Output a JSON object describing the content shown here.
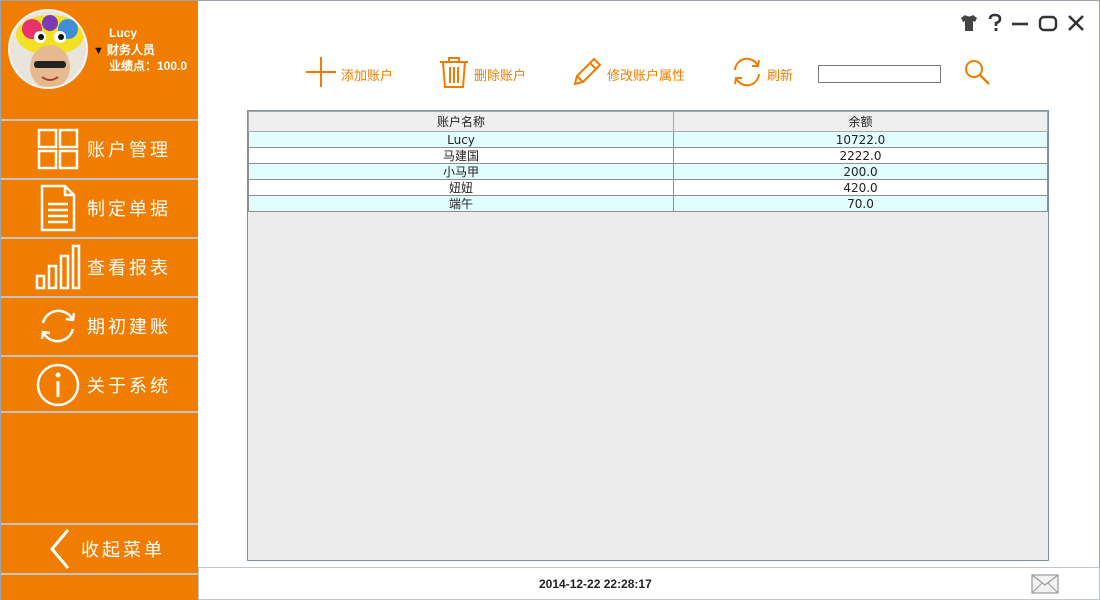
{
  "user": {
    "name": "Lucy",
    "role": "财务人员",
    "score_label": "业绩点：100.0"
  },
  "sidebar": {
    "items": [
      {
        "label": "账户管理",
        "icon": "grid-icon"
      },
      {
        "label": "制定单据",
        "icon": "document-icon"
      },
      {
        "label": "查看报表",
        "icon": "bar-chart-icon"
      },
      {
        "label": "期初建账",
        "icon": "refresh-icon"
      },
      {
        "label": "关于系统",
        "icon": "info-icon"
      }
    ],
    "collapse_label": "收起菜单"
  },
  "toolbar": {
    "add_label": "添加账户",
    "delete_label": "删除账户",
    "edit_label": "修改账户属性",
    "refresh_label": "刷新",
    "search_value": ""
  },
  "table": {
    "headers": [
      "账户名称",
      "余额"
    ],
    "rows": [
      [
        "Lucy",
        "10722.0"
      ],
      [
        "马建国",
        "2222.0"
      ],
      [
        "小马甲",
        "200.0"
      ],
      [
        "妞妞",
        "420.0"
      ],
      [
        "端午",
        "70.0"
      ]
    ]
  },
  "status": {
    "datetime": "2014-12-22 22:28:17"
  },
  "colors": {
    "accent": "#f07d00",
    "row_alt": "#e1fdfd",
    "table_bg": "#ececec"
  }
}
